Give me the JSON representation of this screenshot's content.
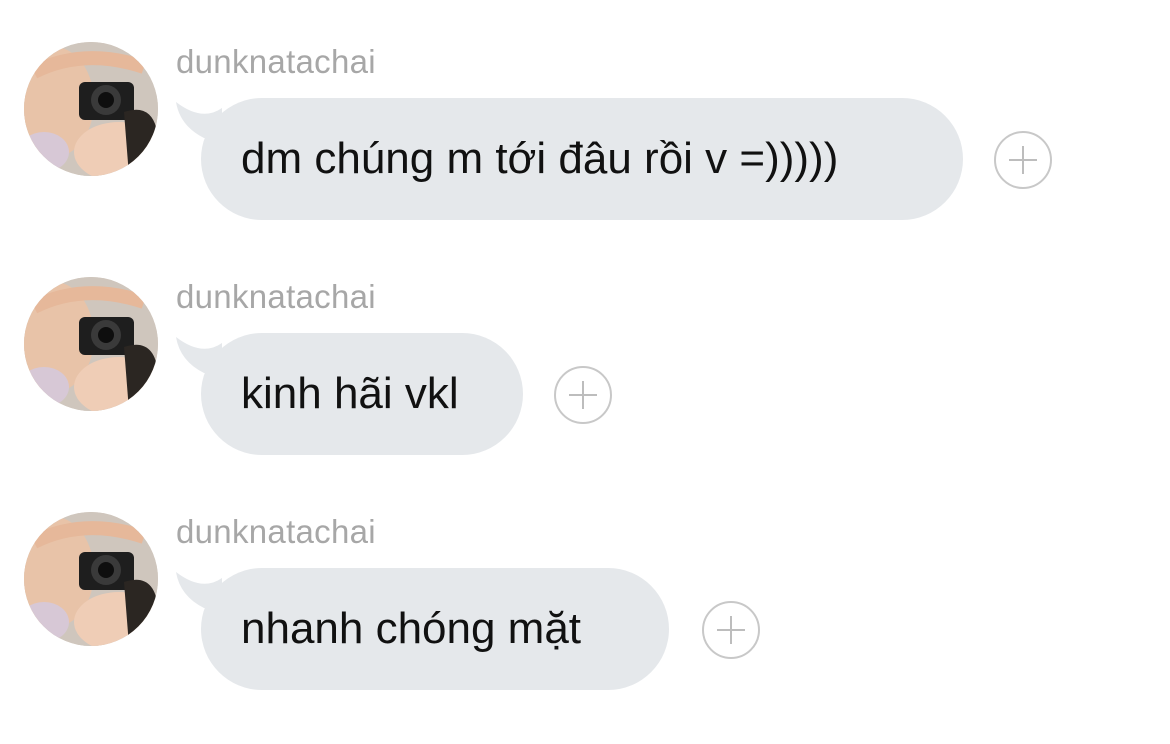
{
  "messages": [
    {
      "username": "dunknatachai",
      "text": "dm chúng m tới đâu rồi v =)))))"
    },
    {
      "username": "dunknatachai",
      "text": "kinh hãi vkl"
    },
    {
      "username": "dunknatachai",
      "text": "nhanh chóng mặt"
    }
  ],
  "colors": {
    "bubble": "#e5e8eb",
    "username": "#a7a7a7",
    "text": "#111111"
  }
}
